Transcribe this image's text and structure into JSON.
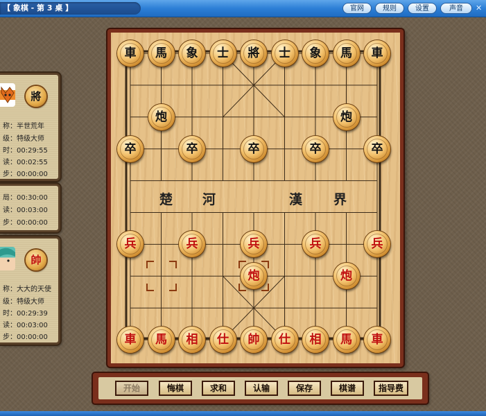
{
  "window": {
    "title": "【 象棋 - 第 3 桌 】",
    "close": "✕"
  },
  "toolbar": [
    "官网",
    "规则",
    "设置",
    "声音"
  ],
  "opponent": {
    "badge": "將",
    "rows": [
      "称：半世荒年",
      "级：特级大师",
      "时：00:29:55",
      "读：00:02:55",
      "步：00:00:00"
    ]
  },
  "settings_panel": {
    "rows": [
      "局：00:30:00",
      "读：00:03:00",
      "步：00:00:00"
    ]
  },
  "player": {
    "badge": "帥",
    "rows": [
      "称：大大的天使",
      "级：特级大师",
      "时：00:29:39",
      "读：00:03:00",
      "步：00:00:00"
    ]
  },
  "board": {
    "river_left": [
      "楚",
      "河"
    ],
    "river_right": [
      "漢",
      "界"
    ],
    "pieces": [
      {
        "c": 0,
        "r": 0,
        "t": "車",
        "s": "black"
      },
      {
        "c": 1,
        "r": 0,
        "t": "馬",
        "s": "black"
      },
      {
        "c": 2,
        "r": 0,
        "t": "象",
        "s": "black"
      },
      {
        "c": 3,
        "r": 0,
        "t": "士",
        "s": "black"
      },
      {
        "c": 4,
        "r": 0,
        "t": "將",
        "s": "black"
      },
      {
        "c": 5,
        "r": 0,
        "t": "士",
        "s": "black"
      },
      {
        "c": 6,
        "r": 0,
        "t": "象",
        "s": "black"
      },
      {
        "c": 7,
        "r": 0,
        "t": "馬",
        "s": "black"
      },
      {
        "c": 8,
        "r": 0,
        "t": "車",
        "s": "black"
      },
      {
        "c": 1,
        "r": 2,
        "t": "炮",
        "s": "black"
      },
      {
        "c": 7,
        "r": 2,
        "t": "炮",
        "s": "black"
      },
      {
        "c": 0,
        "r": 3,
        "t": "卒",
        "s": "black"
      },
      {
        "c": 2,
        "r": 3,
        "t": "卒",
        "s": "black"
      },
      {
        "c": 4,
        "r": 3,
        "t": "卒",
        "s": "black"
      },
      {
        "c": 6,
        "r": 3,
        "t": "卒",
        "s": "black"
      },
      {
        "c": 8,
        "r": 3,
        "t": "卒",
        "s": "black"
      },
      {
        "c": 0,
        "r": 6,
        "t": "兵",
        "s": "red"
      },
      {
        "c": 2,
        "r": 6,
        "t": "兵",
        "s": "red"
      },
      {
        "c": 4,
        "r": 6,
        "t": "兵",
        "s": "red"
      },
      {
        "c": 6,
        "r": 6,
        "t": "兵",
        "s": "red"
      },
      {
        "c": 8,
        "r": 6,
        "t": "兵",
        "s": "red"
      },
      {
        "c": 4,
        "r": 7,
        "t": "炮",
        "s": "red"
      },
      {
        "c": 7,
        "r": 7,
        "t": "炮",
        "s": "red"
      },
      {
        "c": 0,
        "r": 9,
        "t": "車",
        "s": "red"
      },
      {
        "c": 1,
        "r": 9,
        "t": "馬",
        "s": "red"
      },
      {
        "c": 2,
        "r": 9,
        "t": "相",
        "s": "red"
      },
      {
        "c": 3,
        "r": 9,
        "t": "仕",
        "s": "red"
      },
      {
        "c": 4,
        "r": 9,
        "t": "帥",
        "s": "red"
      },
      {
        "c": 5,
        "r": 9,
        "t": "仕",
        "s": "red"
      },
      {
        "c": 6,
        "r": 9,
        "t": "相",
        "s": "red"
      },
      {
        "c": 7,
        "r": 9,
        "t": "馬",
        "s": "red"
      },
      {
        "c": 8,
        "r": 9,
        "t": "車",
        "s": "red"
      }
    ],
    "move_markers": [
      {
        "c": 1,
        "r": 7
      },
      {
        "c": 4,
        "r": 7
      }
    ]
  },
  "actions": [
    {
      "label": "开始",
      "enabled": false
    },
    {
      "label": "悔棋",
      "enabled": true
    },
    {
      "label": "求和",
      "enabled": true
    },
    {
      "label": "认输",
      "enabled": true
    },
    {
      "label": "保存",
      "enabled": true
    },
    {
      "label": "棋谱",
      "enabled": true
    },
    {
      "label": "指导费",
      "enabled": true
    }
  ]
}
